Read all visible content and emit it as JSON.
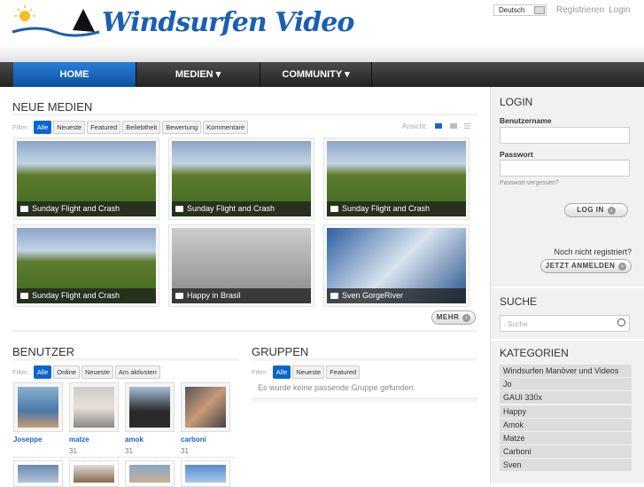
{
  "header": {
    "logo_text": "Windsurfen Video",
    "language": "Deutsch",
    "register": "Registrieren",
    "login": "Login"
  },
  "nav": [
    {
      "label": "HOME"
    },
    {
      "label": "MEDIEN ▾"
    },
    {
      "label": "COMMUNITY ▾"
    }
  ],
  "media": {
    "title": "NEUE MEDIEN",
    "filter_label": "Filter:",
    "filters": [
      "Alle",
      "Neueste",
      "Featured",
      "Beliebtheit",
      "Bewertung",
      "Kommentare"
    ],
    "view_label": "Ansicht:",
    "items": [
      {
        "caption": "Sunday Flight and Crash",
        "type": "field"
      },
      {
        "caption": "Sunday Flight and Crash",
        "type": "field"
      },
      {
        "caption": "Sunday Flight and Crash",
        "type": "field"
      },
      {
        "caption": "Sunday Flight and Crash",
        "type": "field"
      },
      {
        "caption": "Happy in Brasil",
        "type": "clap"
      },
      {
        "caption": "Sven GorgeRiver",
        "type": "kite"
      }
    ],
    "more": "MEHR"
  },
  "users": {
    "title": "BENUTZER",
    "filter_label": "Filter:",
    "filters": [
      "Alle",
      "Online",
      "Neueste",
      "Am aktivsten"
    ],
    "items": [
      {
        "name": "Joseppe",
        "count": ""
      },
      {
        "name": "matze",
        "count": "31"
      },
      {
        "name": "amok",
        "count": "31"
      },
      {
        "name": "carboni",
        "count": "31"
      }
    ]
  },
  "groups": {
    "title": "GRUPPEN",
    "filter_label": "Filter:",
    "filters": [
      "Alle",
      "Neueste",
      "Featured"
    ],
    "empty": "Es wurde keine passende Gruppe gefunden."
  },
  "login": {
    "title": "LOGIN",
    "username_label": "Benutzername",
    "password_label": "Passwort",
    "forgot": "Passwort vergessen?",
    "button": "LOG IN",
    "not_registered": "Noch nicht registriert?",
    "register_button": "JETZT ANMELDEN"
  },
  "search": {
    "title": "SUCHE",
    "placeholder": "Suche"
  },
  "categories": {
    "title": "KATEGORIEN",
    "items": [
      "Windsurfen Manöver und Videos",
      "Jo",
      "GAUI 330x",
      "Happy",
      "Amok",
      "Matze",
      "Carboni",
      "Sven"
    ]
  },
  "colors": {
    "accent": "#0a66cc",
    "nav": "#2a2a2a"
  }
}
